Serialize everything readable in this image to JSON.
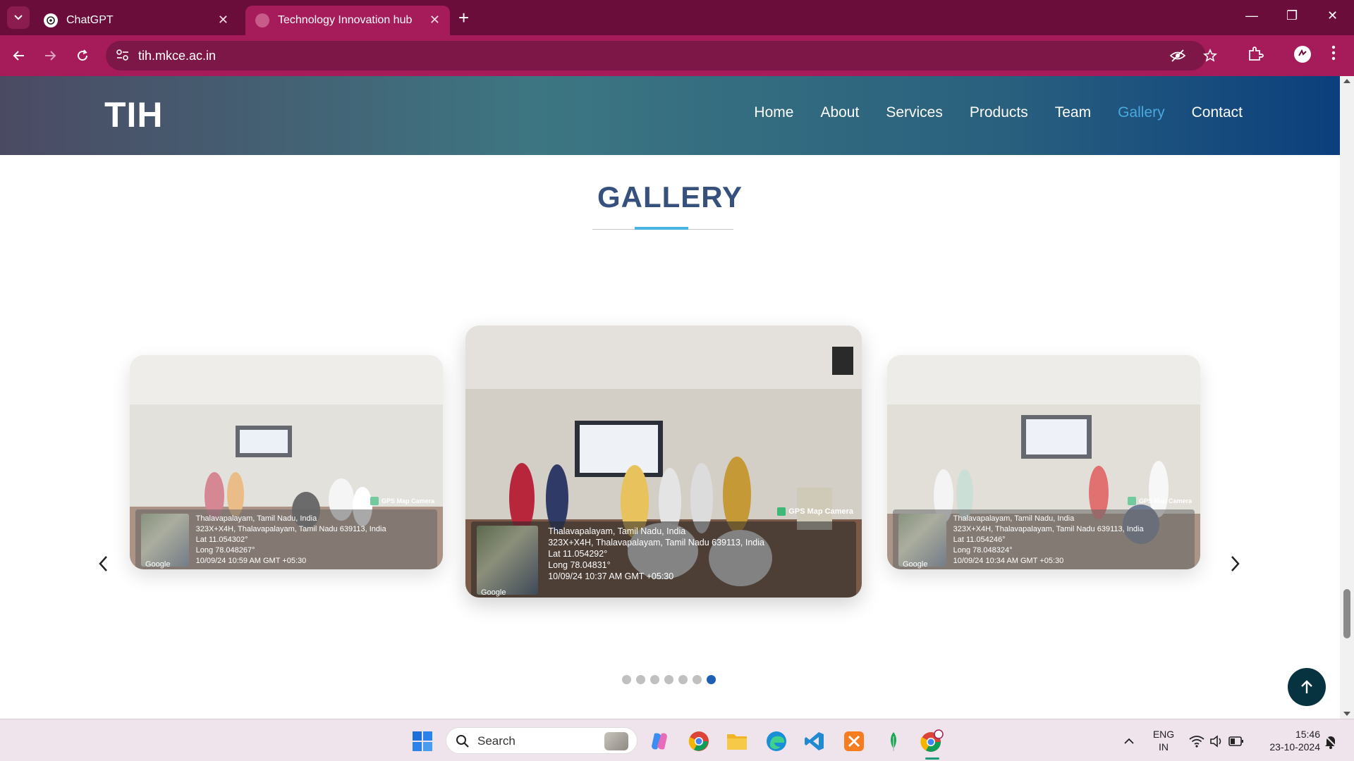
{
  "browser": {
    "tabs": [
      {
        "title": "ChatGPT",
        "active": false
      },
      {
        "title": "Technology Innovation hub",
        "active": true
      }
    ],
    "url": "tih.mkce.ac.in",
    "accent": "#a61b5a",
    "frame_color": "#6b0d3a"
  },
  "site": {
    "logo": "TIH",
    "nav": [
      {
        "label": "Home"
      },
      {
        "label": "About"
      },
      {
        "label": "Services"
      },
      {
        "label": "Products"
      },
      {
        "label": "Team"
      },
      {
        "label": "Gallery",
        "active": true
      },
      {
        "label": "Contact"
      }
    ]
  },
  "gallery": {
    "title": "GALLERY",
    "slides": [
      {
        "position": "left",
        "location": "Thalavapalayam, Tamil Nadu, India",
        "address": "323X+X4H, Thalavapalayam, Tamil Nadu 639113, India",
        "lat": "Lat 11.054302°",
        "long": "Long 78.048267°",
        "time": "10/09/24 10:59 AM GMT +05:30",
        "tag": "GPS Map Camera",
        "credit": "Google"
      },
      {
        "position": "center",
        "location": "Thalavapalayam, Tamil Nadu, India",
        "address": "323X+X4H, Thalavapalayam, Tamil Nadu 639113, India",
        "lat": "Lat 11.054292°",
        "long": "Long 78.04831°",
        "time": "10/09/24 10:37 AM GMT +05:30",
        "tag": "GPS Map Camera",
        "credit": "Google"
      },
      {
        "position": "right",
        "location": "Thalavapalayam, Tamil Nadu, India",
        "address": "323X+X4H, Thalavapalayam, Tamil Nadu 639113, India",
        "lat": "Lat 11.054246°",
        "long": "Long 78.048324°",
        "time": "10/09/24 10:34 AM GMT +05:30",
        "tag": "GPS Map Camera",
        "credit": "Google"
      }
    ],
    "dot_count": 7,
    "active_dot": 6
  },
  "taskbar": {
    "search_label": "Search",
    "lang_line1": "ENG",
    "lang_line2": "IN",
    "time": "15:46",
    "date": "23-10-2024"
  }
}
